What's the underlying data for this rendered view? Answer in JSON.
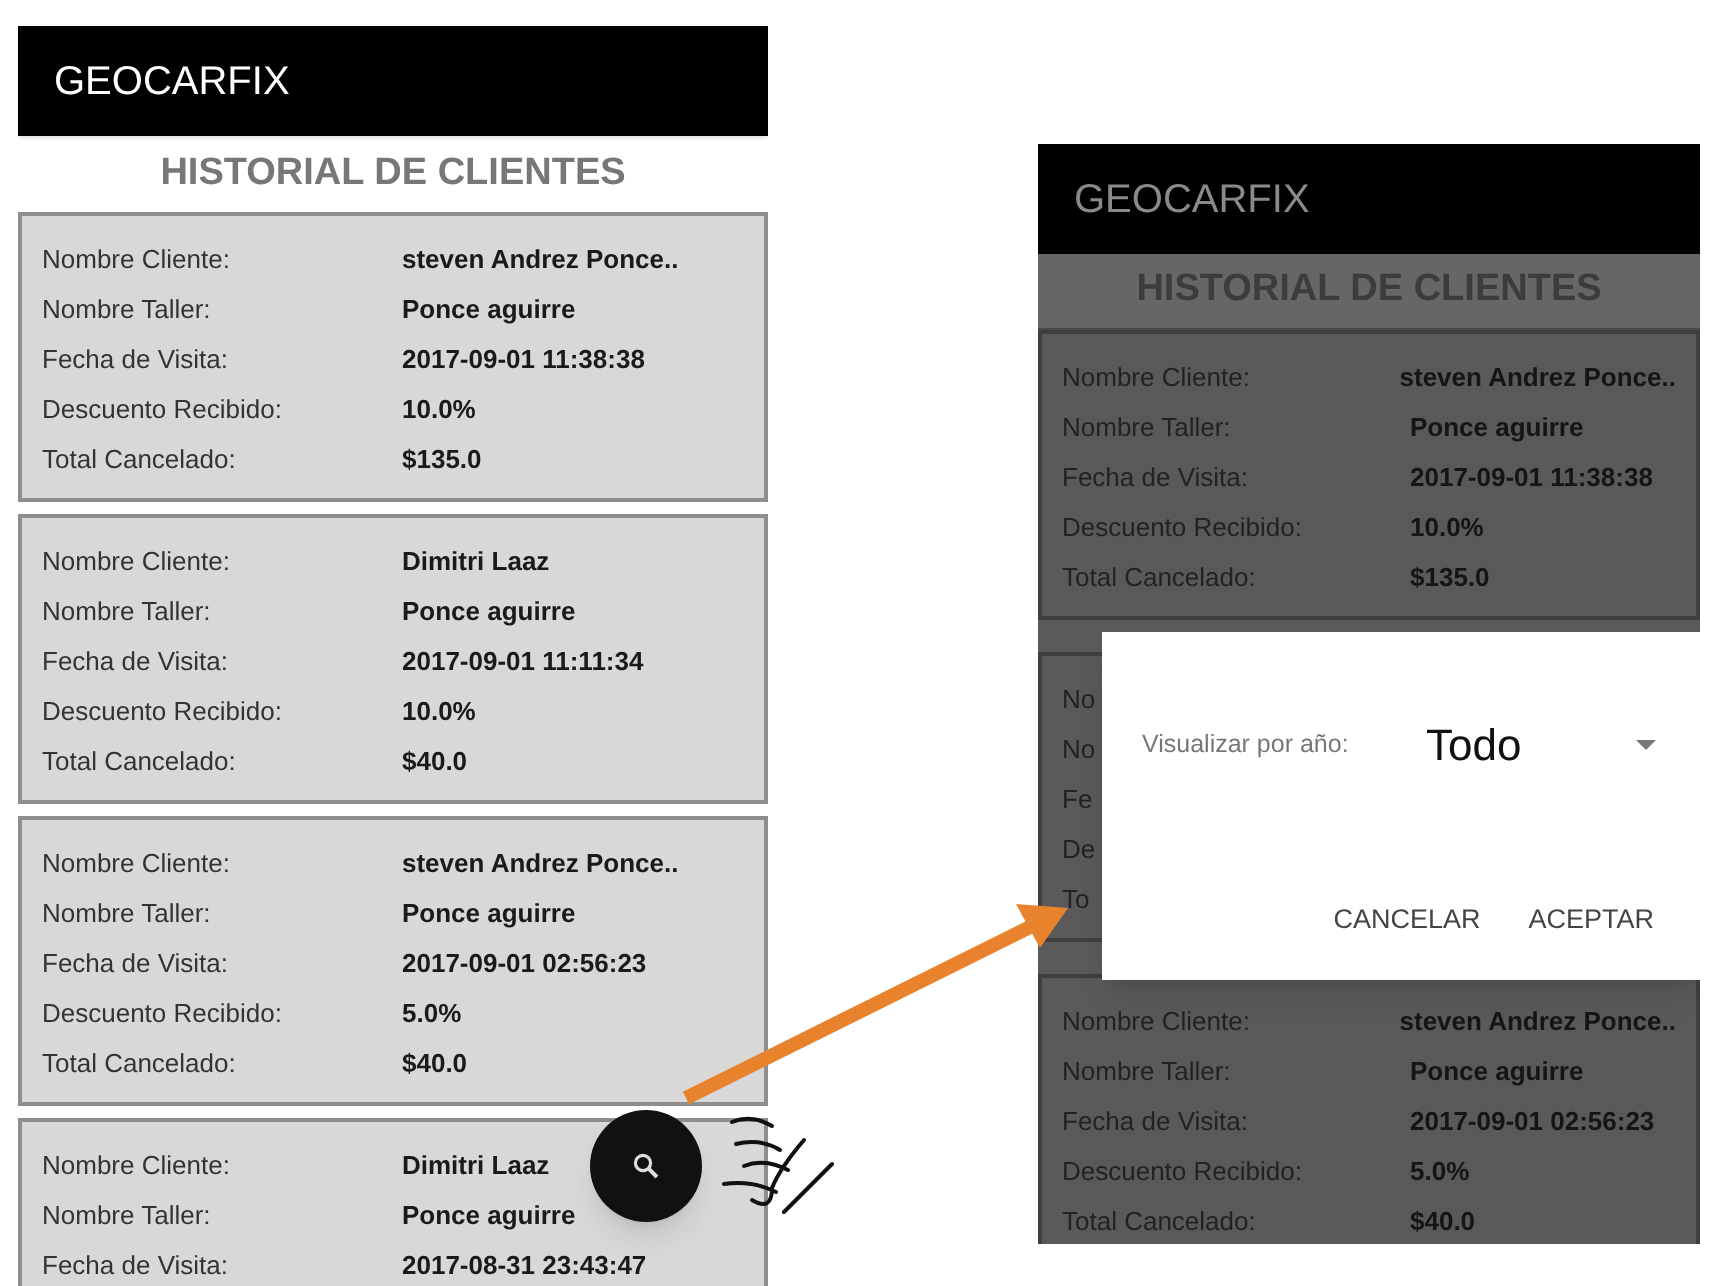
{
  "screens": [
    {
      "app_bar": {
        "title": "GEOCARFIX"
      },
      "heading": "HISTORIAL DE CLIENTES",
      "dimmed": false,
      "fab": true,
      "cards": [
        {
          "rows": [
            {
              "label": "Nombre Cliente:",
              "value": "steven Andrez Ponce.."
            },
            {
              "label": "Nombre Taller:",
              "value": "Ponce aguirre"
            },
            {
              "label": "Fecha de Visita:",
              "value": "2017-09-01 11:38:38"
            },
            {
              "label": "Descuento Recibido:",
              "value": "10.0%"
            },
            {
              "label": "Total Cancelado:",
              "value": "$135.0"
            }
          ]
        },
        {
          "rows": [
            {
              "label": "Nombre Cliente:",
              "value": "Dimitri Laaz"
            },
            {
              "label": "Nombre Taller:",
              "value": "Ponce aguirre"
            },
            {
              "label": "Fecha de Visita:",
              "value": "2017-09-01 11:11:34"
            },
            {
              "label": "Descuento Recibido:",
              "value": "10.0%"
            },
            {
              "label": "Total Cancelado:",
              "value": "$40.0"
            }
          ]
        },
        {
          "rows": [
            {
              "label": "Nombre Cliente:",
              "value": "steven Andrez Ponce.."
            },
            {
              "label": "Nombre Taller:",
              "value": "Ponce aguirre"
            },
            {
              "label": "Fecha de Visita:",
              "value": "2017-09-01 02:56:23"
            },
            {
              "label": "Descuento Recibido:",
              "value": "5.0%"
            },
            {
              "label": "Total Cancelado:",
              "value": "$40.0"
            }
          ]
        },
        {
          "rows": [
            {
              "label": "Nombre Cliente:",
              "value": "Dimitri Laaz"
            },
            {
              "label": "Nombre Taller:",
              "value": "Ponce aguirre"
            },
            {
              "label": "Fecha de Visita:",
              "value": "2017-08-31 23:43:47"
            }
          ]
        }
      ]
    },
    {
      "app_bar": {
        "title": "GEOCARFIX"
      },
      "heading": "HISTORIAL DE CLIENTES",
      "dimmed": true,
      "cards": [
        {
          "rows": [
            {
              "label": "Nombre Cliente:",
              "value": "steven Andrez Ponce.."
            },
            {
              "label": "Nombre Taller:",
              "value": "Ponce aguirre"
            },
            {
              "label": "Fecha de Visita:",
              "value": "2017-09-01 11:38:38"
            },
            {
              "label": "Descuento Recibido:",
              "value": "10.0%"
            },
            {
              "label": "Total Cancelado:",
              "value": "$135.0"
            }
          ]
        },
        {
          "rows": [
            {
              "label": "No"
            },
            {
              "label": "No"
            },
            {
              "label": "Fe"
            },
            {
              "label": "De"
            },
            {
              "label": "To"
            }
          ]
        },
        {
          "rows": [
            {
              "label": "Nombre Cliente:",
              "value": "steven Andrez Ponce.."
            },
            {
              "label": "Nombre Taller:",
              "value": "Ponce aguirre"
            },
            {
              "label": "Fecha de Visita:",
              "value": "2017-09-01 02:56:23"
            },
            {
              "label": "Descuento Recibido:",
              "value": "5.0%"
            },
            {
              "label": "Total Cancelado:",
              "value": "$40.0"
            }
          ]
        }
      ],
      "dialog": {
        "label": "Visualizar por año:",
        "value": "Todo",
        "buttons": [
          "CANCELAR",
          "ACEPTAR"
        ]
      }
    }
  ]
}
